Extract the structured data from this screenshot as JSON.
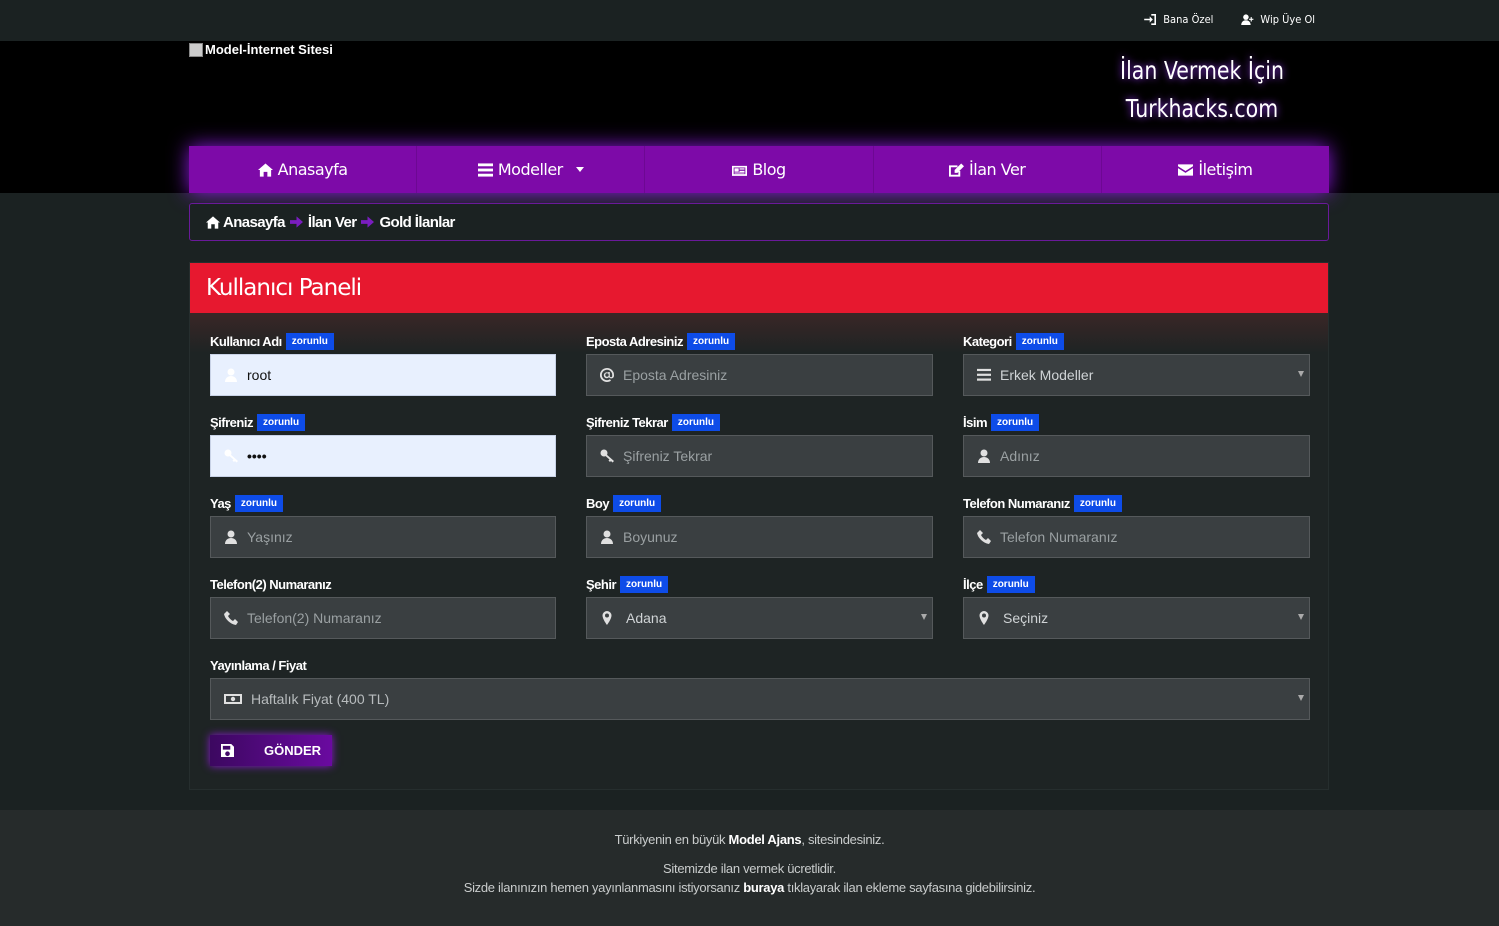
{
  "topbar": {
    "links": [
      {
        "label": "Bana Özel",
        "icon": "login-icon"
      },
      {
        "label": "Wip Üye Ol",
        "icon": "user-plus-icon"
      }
    ]
  },
  "header": {
    "logo_alt": "Model-İnternet Sitesi",
    "promo_line1": "İlan Vermek İçin",
    "promo_line2": "Turkhacks.com"
  },
  "nav": {
    "home": "Anasayfa",
    "models": "Modeller",
    "blog": "Blog",
    "post_ad": "İlan Ver",
    "contact": "İletişim"
  },
  "breadcrumb": {
    "items": [
      "Anasayfa",
      "İlan Ver",
      "Gold İlanlar"
    ]
  },
  "panel": {
    "title": "Kullanıcı Paneli",
    "required_badge": "zorunlu",
    "fields": {
      "username": {
        "label": "Kullanıcı Adı",
        "value": "root"
      },
      "email": {
        "label": "Eposta Adresiniz",
        "placeholder": "Eposta Adresiniz"
      },
      "category": {
        "label": "Kategori",
        "value": "Erkek Modeller"
      },
      "password": {
        "label": "Şifreniz",
        "value": "••••"
      },
      "password_repeat": {
        "label": "Şifreniz Tekrar",
        "placeholder": "Şifreniz Tekrar"
      },
      "name": {
        "label": "İsim",
        "placeholder": "Adınız"
      },
      "age": {
        "label": "Yaş",
        "placeholder": "Yaşınız"
      },
      "height": {
        "label": "Boy",
        "placeholder": "Boyunuz"
      },
      "phone": {
        "label": "Telefon Numaranız",
        "placeholder": "Telefon Numaranız"
      },
      "phone2": {
        "label": "Telefon(2) Numaranız",
        "placeholder": "Telefon(2) Numaranız"
      },
      "city": {
        "label": "Şehir",
        "value": "Adana"
      },
      "district": {
        "label": "İlçe",
        "value": "Seçiniz"
      },
      "pricing": {
        "label": "Yayınlama / Fiyat",
        "value": "Haftalık Fiyat (400 TL)"
      }
    },
    "submit_label": "GÖNDER"
  },
  "footer": {
    "line1_a": "Türkiyenin en büyük ",
    "line1_b": "Model Ajans",
    "line1_c": ", sitesindesiniz.",
    "line2": "Sitemizde ilan vermek ücretlidir.",
    "line3_a": "Sizde ilanınızın hemen yayınlanmasını istiyorsanız ",
    "line3_b": "buraya",
    "line3_c": " tıklayarak ilan ekleme sayfasına gidebilirsiniz."
  },
  "colors": {
    "accent_purple": "#7d0aa8",
    "panel_red": "#e7182f",
    "badge_blue": "#0e4ce8"
  }
}
